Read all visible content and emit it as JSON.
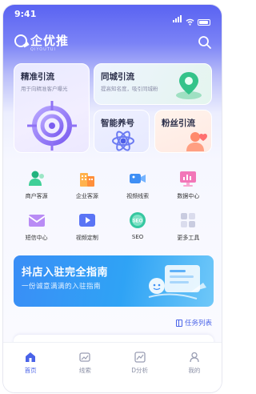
{
  "status_bar": {
    "time": "9:41"
  },
  "header": {
    "logo_text": "企优推",
    "logo_subtitle": "QIYOUTUI"
  },
  "feature_cards": [
    {
      "title": "精准引流",
      "subtitle": "用于向精准客户曝光"
    },
    {
      "title": "同城引流",
      "subtitle": "提高知名度，吸引同城粉"
    },
    {
      "title": "智能养号",
      "subtitle": ""
    },
    {
      "title": "粉丝引流",
      "subtitle": ""
    }
  ],
  "grid_items": [
    {
      "label": "商户客源",
      "icon": "merchant-users-icon"
    },
    {
      "label": "企业客源",
      "icon": "enterprise-building-icon"
    },
    {
      "label": "视频线索",
      "icon": "video-camera-icon"
    },
    {
      "label": "数据中心",
      "icon": "data-monitor-icon"
    },
    {
      "label": "短信中心",
      "icon": "sms-envelope-icon"
    },
    {
      "label": "视频定制",
      "icon": "video-custom-icon"
    },
    {
      "label": "SEO",
      "icon": "seo-icon"
    },
    {
      "label": "更多工具",
      "icon": "more-tools-icon"
    }
  ],
  "banner": {
    "title": "抖店入驻完全指南",
    "subtitle": "一份诚意满满的入驻指南"
  },
  "task_list": {
    "label": "任务列表"
  },
  "tabbar": {
    "items": [
      {
        "label": "首页",
        "active": true,
        "icon": "home-icon"
      },
      {
        "label": "线索",
        "active": false,
        "icon": "leads-icon"
      },
      {
        "label": "D分析",
        "active": false,
        "icon": "analytics-icon"
      },
      {
        "label": "我的",
        "active": false,
        "icon": "profile-icon"
      }
    ]
  },
  "colors": {
    "primary": "#4a63e8",
    "header_gradient": "#5a63f2",
    "banner_blue": "#2fa3f5"
  }
}
